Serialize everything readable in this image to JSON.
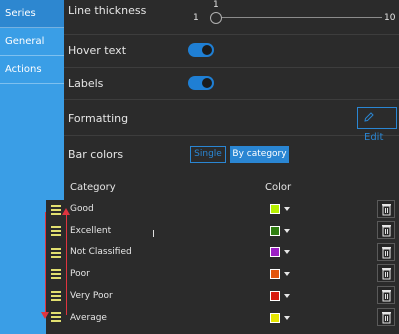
{
  "sidebar": {
    "items": [
      {
        "label": "Series"
      },
      {
        "label": "General"
      },
      {
        "label": "Actions"
      }
    ]
  },
  "line_thickness": {
    "label": "Line thickness",
    "value": "1",
    "min": "1",
    "max": "10"
  },
  "hover_text": {
    "label": "Hover text",
    "enabled": true
  },
  "labels": {
    "label": "Labels",
    "enabled": true
  },
  "formatting": {
    "label": "Formatting",
    "edit_label": "Edit"
  },
  "bar_colors": {
    "label": "Bar colors",
    "options": [
      "Single",
      "By category"
    ],
    "selected": "By category"
  },
  "category_table": {
    "headers": {
      "category": "Category",
      "color": "Color"
    },
    "rows": [
      {
        "name": "Good",
        "color": "#b6f000"
      },
      {
        "name": "Excellent",
        "color": "#2f7d10"
      },
      {
        "name": "Not Classified",
        "color": "#9b1fc4"
      },
      {
        "name": "Poor",
        "color": "#e3550e"
      },
      {
        "name": "Very Poor",
        "color": "#d81c10"
      },
      {
        "name": "Average",
        "color": "#e4e400"
      }
    ]
  },
  "colors": {
    "accent": "#2a86d3",
    "sidebar": "#3a9ee6"
  }
}
